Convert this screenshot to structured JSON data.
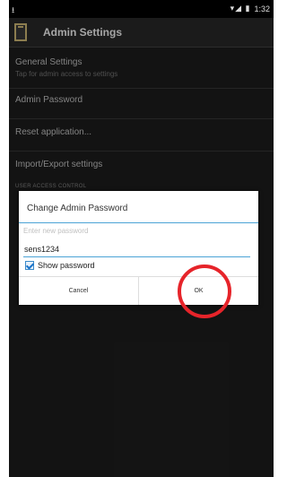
{
  "status_bar": {
    "left": "⭳",
    "time": "1:32",
    "icons": "▾◢ ▮"
  },
  "action_bar": {
    "title": "Admin Settings"
  },
  "settings": {
    "general": {
      "title": "General Settings",
      "subtitle": "Tap for admin access to settings"
    },
    "admin_password": "Admin Password",
    "reset": "Reset application...",
    "import_export": "Import/Export settings",
    "section_user_access": "USER ACCESS CONTROL"
  },
  "dialog": {
    "title": "Change Admin Password",
    "placeholder": "Enter new password",
    "value": "sens1234",
    "show_password": "Show password",
    "cancel": "Cancel",
    "ok": "OK"
  },
  "colors": {
    "accent": "#4ba3d6",
    "highlight": "#e6242a"
  }
}
